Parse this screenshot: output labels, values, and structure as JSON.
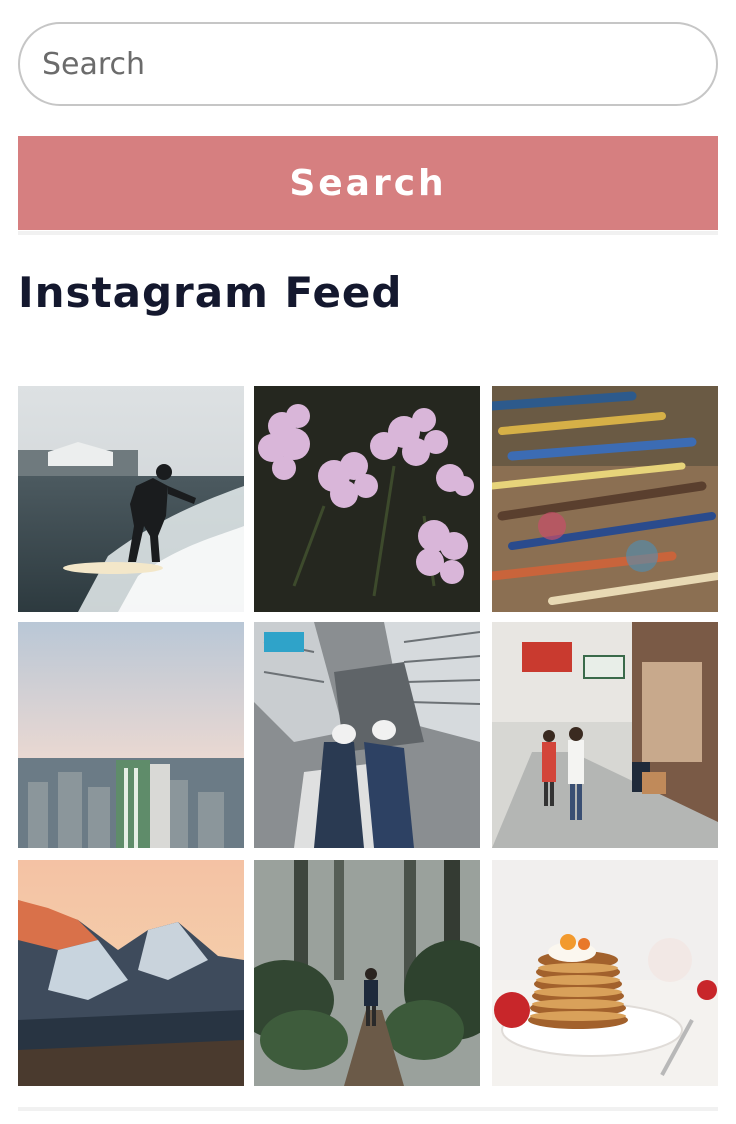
{
  "search": {
    "placeholder": "Search",
    "button_label": "Search"
  },
  "feed": {
    "title": "Instagram Feed",
    "posts": [
      {
        "subject": "surfer riding a wave"
      },
      {
        "subject": "pink yarrow flowers"
      },
      {
        "subject": "paint brushes on palette"
      },
      {
        "subject": "city skyline at dusk"
      },
      {
        "subject": "legs over skyscraper edge"
      },
      {
        "subject": "street scene with pedestrians"
      },
      {
        "subject": "mountains at sunset"
      },
      {
        "subject": "hiker in misty forest"
      },
      {
        "subject": "stack of pancakes with fruit"
      }
    ]
  },
  "colors": {
    "button": "#d67f80",
    "title": "#14182e",
    "input_border": "#c6c6c6"
  }
}
